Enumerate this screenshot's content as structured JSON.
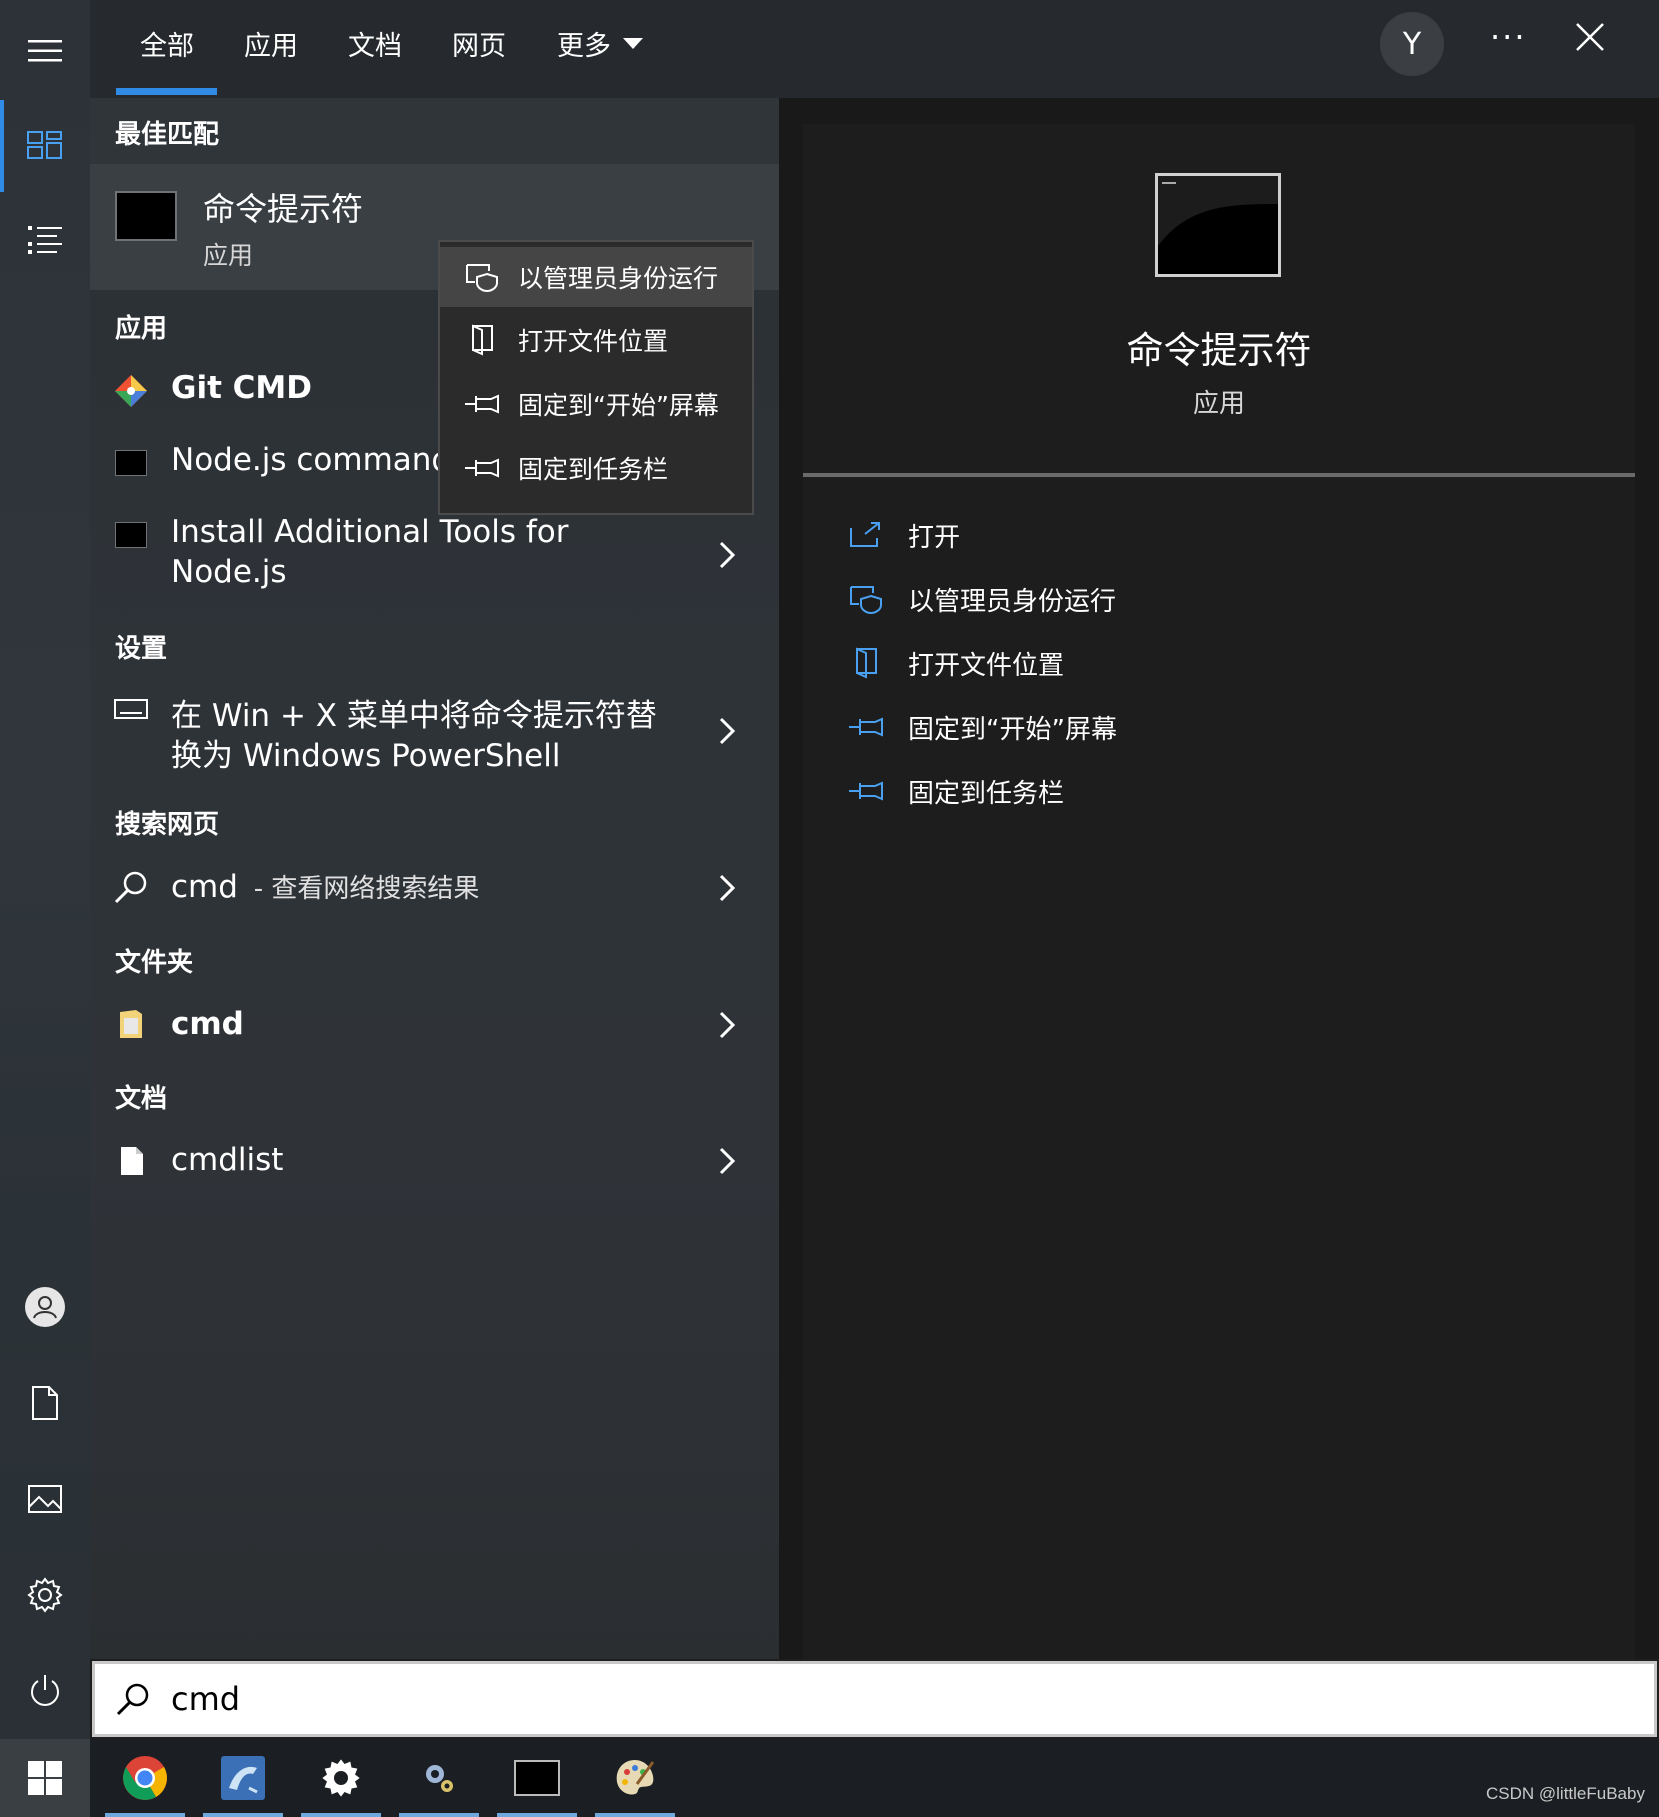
{
  "tabs": [
    {
      "label": "全部",
      "selected": true
    },
    {
      "label": "应用"
    },
    {
      "label": "文档"
    },
    {
      "label": "网页"
    },
    {
      "label": "更多"
    }
  ],
  "avatar_letter": "Y",
  "more_menu": "···",
  "best_match": {
    "header": "最佳匹配",
    "title": "命令提示符",
    "subtitle": "应用"
  },
  "context_menu": [
    {
      "label": "以管理员身份运行",
      "icon": "shield-icon"
    },
    {
      "label": "打开文件位置",
      "icon": "folder-location-icon"
    },
    {
      "label": "固定到“开始”屏幕",
      "icon": "pin-icon"
    },
    {
      "label": "固定到任务栏",
      "icon": "pin-icon"
    }
  ],
  "sections": {
    "apps": "应用",
    "settings": "设置",
    "web": "搜索网页",
    "folders": "文件夹",
    "docs": "文档"
  },
  "apps": [
    {
      "title": "Git CMD"
    },
    {
      "title": "Node.js command"
    },
    {
      "line1": "Install Additional Tools for",
      "line2": "Node.js"
    }
  ],
  "settings_item": {
    "line1": "在 Win + X 菜单中将命令提示符替",
    "line2": "换为 Windows PowerShell"
  },
  "web_item": {
    "title": "cmd",
    "suffix": "- 查看网络搜索结果"
  },
  "folder_item": {
    "title": "cmd"
  },
  "doc_item": {
    "title": "cmdlist"
  },
  "details": {
    "title": "命令提示符",
    "subtitle": "应用",
    "actions": [
      {
        "label": "打开",
        "icon": "open-icon"
      },
      {
        "label": "以管理员身份运行",
        "icon": "shield-icon"
      },
      {
        "label": "打开文件位置",
        "icon": "folder-location-icon"
      },
      {
        "label": "固定到“开始”屏幕",
        "icon": "pin-icon"
      },
      {
        "label": "固定到任务栏",
        "icon": "pin-icon"
      }
    ]
  },
  "search": {
    "value": "cmd"
  },
  "watermark": "CSDN @littleFuBaby",
  "colors": {
    "accent": "#2f8be6"
  }
}
